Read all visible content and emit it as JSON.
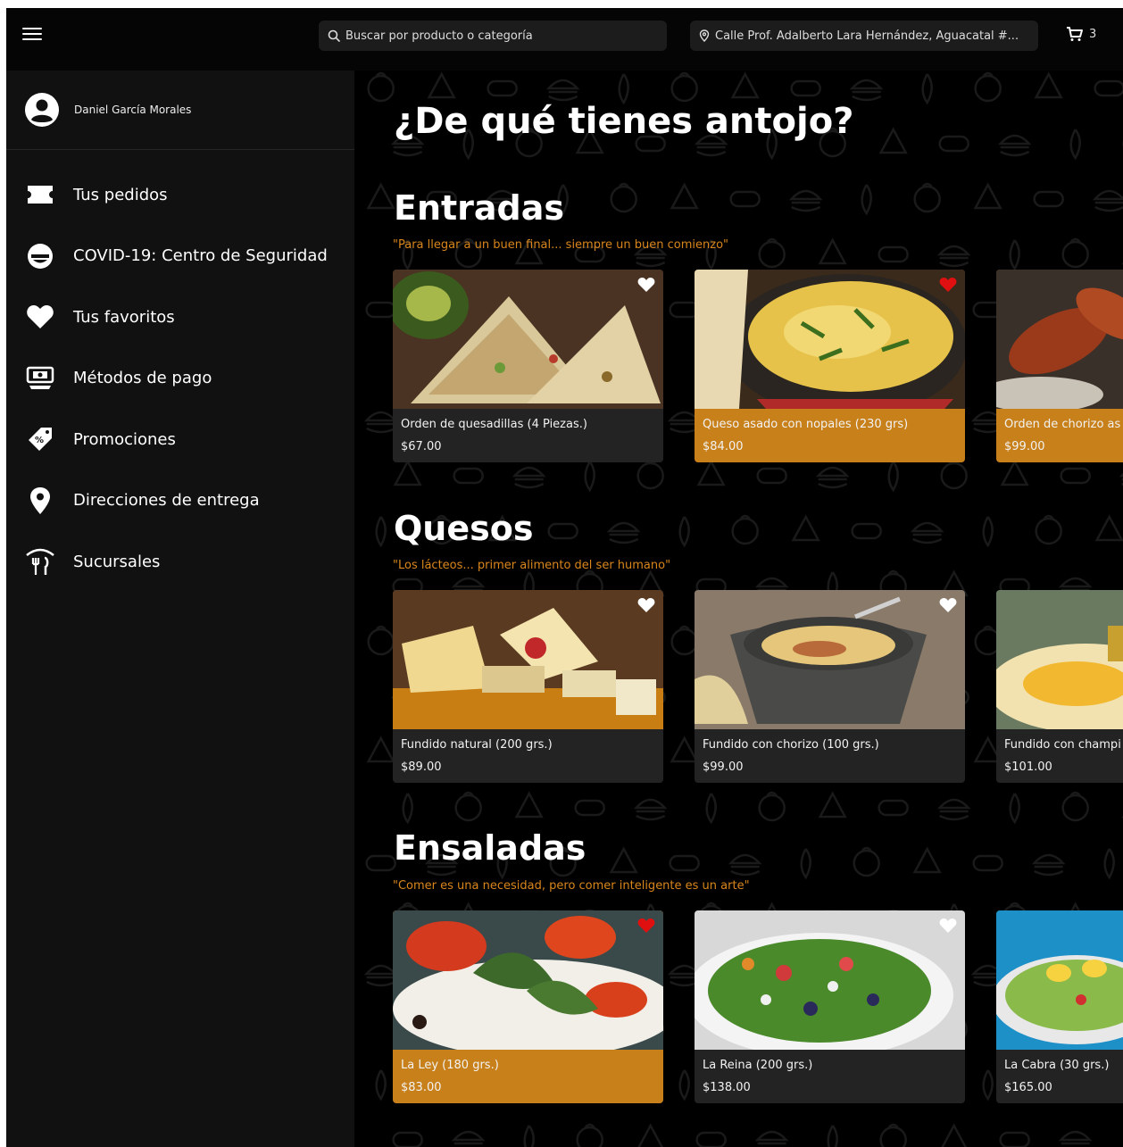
{
  "topbar": {
    "search_placeholder": "Buscar por producto o categoría",
    "address": "Calle Prof. Adalberto Lara Hernández, Aguacatal #...",
    "cart_count": "3"
  },
  "sidebar": {
    "user_name": "Daniel García Morales",
    "items": [
      {
        "label": "Tus pedidos",
        "icon": "ticket-icon"
      },
      {
        "label": "COVID-19: Centro de Seguridad",
        "icon": "mask-icon"
      },
      {
        "label": "Tus favoritos",
        "icon": "heart-icon"
      },
      {
        "label": "Métodos de pago",
        "icon": "payment-icon"
      },
      {
        "label": "Promociones",
        "icon": "tag-icon"
      },
      {
        "label": "Direcciones de entrega",
        "icon": "location-pin-icon"
      },
      {
        "label": "Sucursales",
        "icon": "restaurant-icon"
      }
    ]
  },
  "main": {
    "title": "¿De qué tienes antojo?",
    "sections": [
      {
        "title": "Entradas",
        "quote": "\"Para llegar a un buen final... siempre un buen comienzo\"",
        "products": [
          {
            "name": "Orden de quesadillas (4 Piezas.)",
            "price": "$67.00",
            "favorite": false,
            "highlighted": false
          },
          {
            "name": "Queso asado con nopales (230 grs)",
            "price": "$84.00",
            "favorite": true,
            "highlighted": true
          },
          {
            "name": "Orden de chorizo as",
            "price": "$99.00",
            "favorite": false,
            "highlighted": true
          }
        ]
      },
      {
        "title": "Quesos",
        "quote": "\"Los lácteos... primer alimento del ser humano\"",
        "products": [
          {
            "name": "Fundido natural (200 grs.)",
            "price": "$89.00",
            "favorite": false,
            "highlighted": false
          },
          {
            "name": "Fundido con chorizo (100 grs.)",
            "price": "$99.00",
            "favorite": false,
            "highlighted": false
          },
          {
            "name": "Fundido con champi",
            "price": "$101.00",
            "favorite": false,
            "highlighted": false
          }
        ]
      },
      {
        "title": "Ensaladas",
        "quote": "\"Comer es una necesidad, pero comer inteligente es un arte\"",
        "products": [
          {
            "name": "La Ley (180 grs.)",
            "price": "$83.00",
            "favorite": true,
            "highlighted": true
          },
          {
            "name": "La Reina (200 grs.)",
            "price": "$138.00",
            "favorite": false,
            "highlighted": false
          },
          {
            "name": "La Cabra (30 grs.)",
            "price": "$165.00",
            "favorite": false,
            "highlighted": false
          }
        ]
      }
    ]
  },
  "colors": {
    "accent": "#c8801a",
    "quote": "#d9861c",
    "favorite_active": "#e01010",
    "sidebar_bg": "#111111",
    "card_bg": "#232323"
  }
}
